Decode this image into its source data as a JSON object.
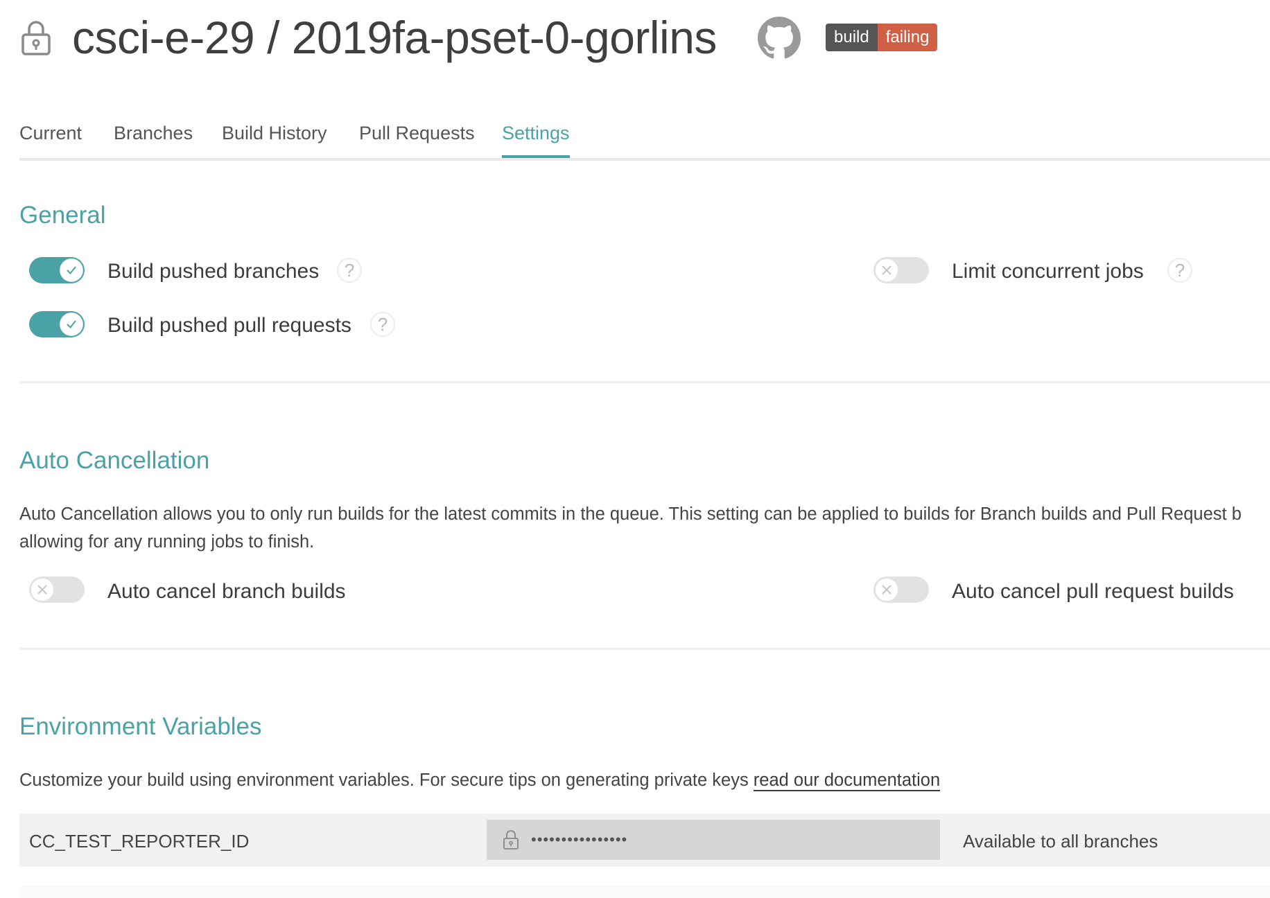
{
  "header": {
    "repo_title": "csci-e-29 / 2019fa-pset-0-gorlins",
    "badge": {
      "left": "build",
      "right": "failing"
    }
  },
  "tabs": [
    {
      "label": "Current",
      "active": false
    },
    {
      "label": "Branches",
      "active": false
    },
    {
      "label": "Build History",
      "active": false
    },
    {
      "label": "Pull Requests",
      "active": false
    },
    {
      "label": "Settings",
      "active": true
    }
  ],
  "general": {
    "title": "General",
    "options": {
      "build_pushed_branches": {
        "label": "Build pushed branches",
        "enabled": true
      },
      "build_pushed_pull_requests": {
        "label": "Build pushed pull requests",
        "enabled": true
      },
      "limit_concurrent_jobs": {
        "label": "Limit concurrent jobs",
        "enabled": false
      }
    },
    "help_symbol": "?"
  },
  "auto_cancellation": {
    "title": "Auto Cancellation",
    "description_line1": "Auto Cancellation allows you to only run builds for the latest commits in the queue. This setting can be applied to builds for Branch builds and Pull Request b",
    "description_line2": "allowing for any running jobs to finish.",
    "options": {
      "auto_cancel_branch_builds": {
        "label": "Auto cancel branch builds",
        "enabled": false
      },
      "auto_cancel_pull_request_builds": {
        "label": "Auto cancel pull request builds",
        "enabled": false
      }
    }
  },
  "environment_variables": {
    "title": "Environment Variables",
    "description": "Customize your build using environment variables. For secure tips on generating private keys ",
    "doc_link": "read our documentation",
    "variables": [
      {
        "name": "CC_TEST_REPORTER_ID",
        "value_masked": "••••••••••••••••",
        "scope": "Available to all branches"
      }
    ]
  },
  "colors": {
    "accent": "#4aa2a6",
    "badge_dark": "#555555",
    "badge_failing": "#d05f46",
    "toggle_off": "#e2e2e2"
  },
  "icons": [
    "lock-icon",
    "github-icon",
    "check-icon",
    "x-icon",
    "help-icon"
  ]
}
